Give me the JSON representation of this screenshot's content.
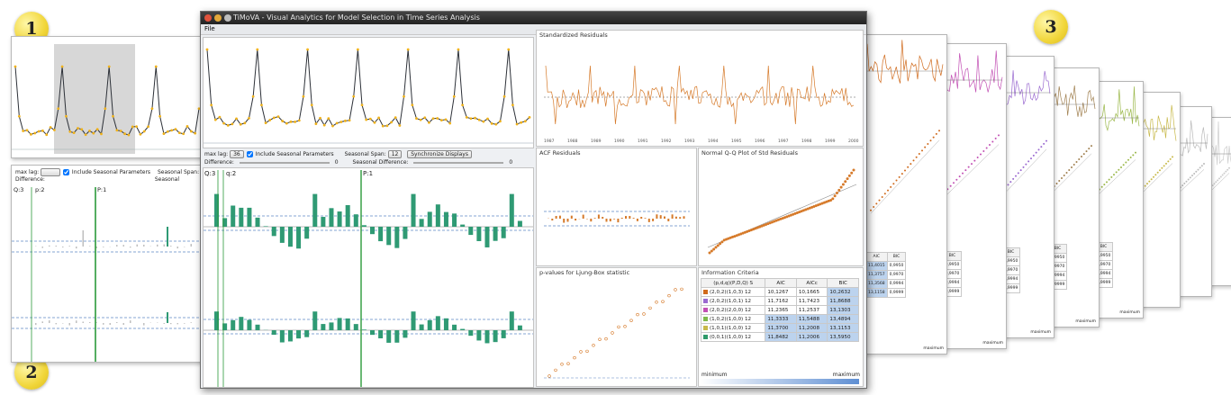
{
  "badges": {
    "one": "1",
    "two": "2",
    "three": "3"
  },
  "window": {
    "title": "TiMoVA - Visual Analytics for Model Selection in Time Series Analysis",
    "menu_file": "File"
  },
  "controls": {
    "max_lag_label": "max lag:",
    "max_lag_value": "36",
    "include_seasonal": "Include Seasonal Parameters",
    "seasonal_span_label": "Seasonal Span:",
    "seasonal_span_value": "12",
    "sync_button": "Synchronize Displays",
    "difference_label": "Difference:",
    "difference_value": "0",
    "seasonal_difference_label": "Seasonal Difference:",
    "seasonal_difference_value": "0"
  },
  "left_panel": {
    "max_lag_label": "max lag:",
    "include_seasonal": "Include Seasonal Parameters",
    "seasonal_span_label": "Seasonal Span:",
    "difference_label": "Difference:",
    "seasonal_label": "Seasonal",
    "markers": [
      "Q:3",
      "p:2",
      "P:1"
    ]
  },
  "acf_markers": [
    "Q:3",
    "q:2",
    "P:1"
  ],
  "plots": {
    "std_residuals": "Standardized Residuals",
    "acf_residuals": "ACF Residuals",
    "qq_plot": "Normal Q-Q Plot of Std Residuals",
    "ljung_box": "p-values for Ljung-Box statistic",
    "info_criteria": "Information Criteria",
    "residual_years": [
      "1987",
      "1988",
      "1989",
      "1990",
      "1991",
      "1992",
      "1993",
      "1994",
      "1995",
      "1996",
      "1997",
      "1998",
      "1999",
      "2000"
    ]
  },
  "info_criteria": {
    "headers": [
      "(p,d,q)(P,D,Q) S",
      "AIC",
      "AICc",
      "BIC"
    ],
    "rows": [
      {
        "model": "(2,0,2)(1,0,3) 12",
        "aic": "10,1267",
        "aicc": "10,1665",
        "bic": "10,2632",
        "color": "#d06a1c"
      },
      {
        "model": "(2,0,2)(1,0,1) 12",
        "aic": "11,7162",
        "aicc": "11,7423",
        "bic": "11,8688",
        "color": "#9a6ad0"
      },
      {
        "model": "(2,0,2)(2,0,0) 12",
        "aic": "11,2365",
        "aicc": "11,2537",
        "bic": "13,1303",
        "color": "#c24fb4"
      },
      {
        "model": "(1,0,2)(1,0,0) 12",
        "aic": "11,3333",
        "aicc": "11,5488",
        "bic": "13,4894",
        "color": "#7db94a"
      },
      {
        "model": "(1,0,1)(1,0,0) 12",
        "aic": "11,3700",
        "aicc": "11,2008",
        "bic": "13,1153",
        "color": "#c8b94a"
      },
      {
        "model": "(0,0,1)(1,0,0) 12",
        "aic": "11,8482",
        "aicc": "11,2006",
        "bic": "13,5950",
        "color": "#2f9a6a"
      }
    ],
    "minimum": "minimum",
    "maximum": "maximum"
  },
  "stack_tables": {
    "headers": [
      "AIC",
      "BIC"
    ],
    "values": [
      "11,4015",
      "0,9950",
      "11,3757",
      "0,9970",
      "11,3568",
      "0,9994",
      "13,1158",
      "0,9999"
    ],
    "minimum": "minimum",
    "maximum": "maximum"
  },
  "colors": {
    "series_line": "#2d3138",
    "series_points": "#f0b21a",
    "acf_bar": "#2f9a74",
    "residual": "#d67a2a",
    "threshold": "#5f86c5",
    "selection": "#d7d7d7"
  }
}
